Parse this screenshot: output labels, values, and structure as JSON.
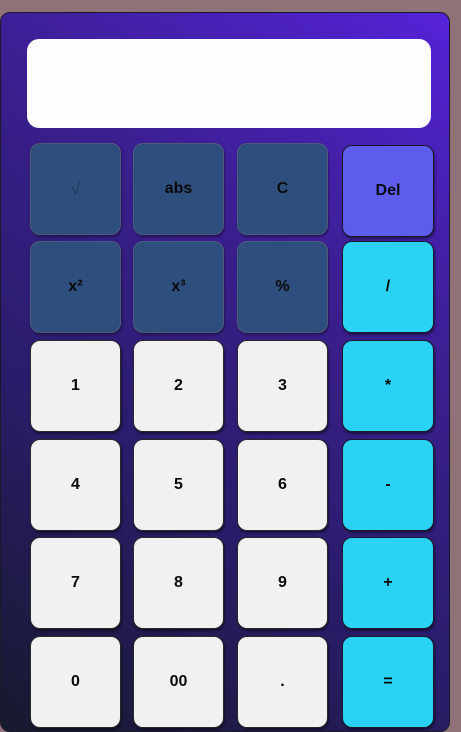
{
  "display": {
    "value": ""
  },
  "keys": {
    "sqrt": "√",
    "abs": "abs",
    "clear": "C",
    "del": "Del",
    "square": "x²",
    "cube": "x³",
    "percent": "%",
    "divide": "/",
    "one": "1",
    "two": "2",
    "three": "3",
    "multiply": "*",
    "four": "4",
    "five": "5",
    "six": "6",
    "subtract": "-",
    "seven": "7",
    "eight": "8",
    "nine": "9",
    "add": "+",
    "zero": "0",
    "double_zero": "00",
    "decimal": ".",
    "equals": "="
  },
  "colors": {
    "function_key": "#2e4f7e",
    "number_key": "#f1f1f1",
    "operator_key": "#2ad2f4",
    "delete_key": "#5e5ced",
    "body_top": "#5522d8",
    "body_bottom": "#161a2e"
  }
}
